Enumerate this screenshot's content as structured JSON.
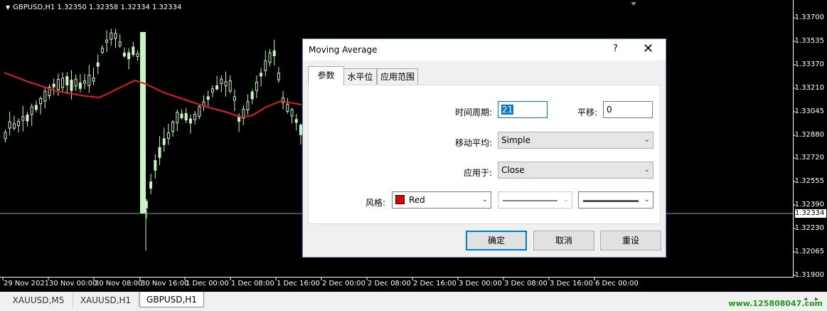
{
  "chart": {
    "header": "GBPUSD,H1  1.32350 1.32358 1.32334 1.32334",
    "current_price": "1.32334",
    "price_labels": [
      "1.33700",
      "1.33535",
      "1.33370",
      "1.33210",
      "1.33045",
      "1.32880",
      "1.32720",
      "1.32555",
      "1.32390",
      "1.32230",
      "1.32065",
      "1.31900"
    ],
    "time_labels": [
      "29 Nov 2021",
      "30 Nov 00:00",
      "30 Nov 08:00",
      "30 Nov 16:00",
      "1 Dec 00:00",
      "1 Dec 08:00",
      "1 Dec 16:00",
      "2 Dec 00:00",
      "2 Dec 08:00",
      "2 Dec 16:00",
      "3 Dec 00:00",
      "3 Dec 08:00",
      "3 Dec 16:00",
      "6 Dec 00:00"
    ],
    "colors": {
      "background": "#000000",
      "candle": "#c8f5c0",
      "ma_line": "#e01e1e",
      "axis_text": "#ffffff"
    }
  },
  "symbol_tabs": [
    {
      "label": "XAUUSD,M5",
      "active": false
    },
    {
      "label": "XAUUSD,H1",
      "active": false
    },
    {
      "label": "GBPUSD,H1",
      "active": true
    }
  ],
  "site_url": "www.125808047.com",
  "dialog": {
    "title": "Moving Average",
    "help_label": "?",
    "close_label": "✕",
    "tabs": [
      "参数",
      "水平位",
      "应用范围"
    ],
    "active_tab": "参数",
    "fields": {
      "period_label": "时间周期:",
      "period_value": "21",
      "shift_label": "平移:",
      "shift_value": "0",
      "method_label": "移动平均:",
      "method_value": "Simple",
      "apply_label": "应用于:",
      "apply_value": "Close",
      "style_label": "风格:",
      "color_value": "Red"
    },
    "buttons": {
      "ok": "确定",
      "cancel": "取消",
      "reset": "重设"
    }
  }
}
